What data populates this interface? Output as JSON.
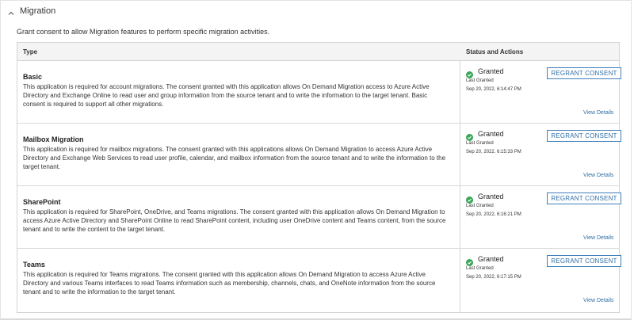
{
  "section": {
    "title": "Migration",
    "description": "Grant consent to allow Migration features to perform specific migration activities."
  },
  "table": {
    "headers": {
      "type": "Type",
      "status": "Status and Actions"
    },
    "rows": [
      {
        "title": "Basic",
        "description": "This application is required for account migrations. The consent granted with this application allows On Demand Migration access to Azure Active Directory and Exchange Online to read user and group information from the source tenant and to write the information to the target tenant. Basic consent is required to support all other migrations.",
        "status": "Granted",
        "last_granted_label": "Last Granted",
        "last_granted_date": "Sep 20, 2022, 6:14:47 PM",
        "button_label": "REGRANT CONSENT",
        "details_label": "View Details"
      },
      {
        "title": "Mailbox Migration",
        "description": "This application is required for mailbox migrations. The consent granted with this applications allows On Demand Migration to access Azure Active Directory and Exchange Web Services to read user profile, calendar, and mailbox information from the source tenant and to write the information to the target tenant.",
        "status": "Granted",
        "last_granted_label": "Last Granted",
        "last_granted_date": "Sep 20, 2022, 6:15:33 PM",
        "button_label": "REGRANT CONSENT",
        "details_label": "View Details"
      },
      {
        "title": "SharePoint",
        "description": "This application is required for SharePoint, OneDrive, and Teams migrations. The consent granted with this application allows On Demand Migration to access Azure Active Directory and SharePoint Online to read SharePoint content, including user OneDrive content and Teams content, from the source tenant and to write the content to the target tenant.",
        "status": "Granted",
        "last_granted_label": "Last Granted",
        "last_granted_date": "Sep 20, 2022, 6:16:21 PM",
        "button_label": "REGRANT CONSENT",
        "details_label": "View Details"
      },
      {
        "title": "Teams",
        "description": "This application is required for Teams migrations. The consent granted with this application allows On Demand Migration to access Azure Active Directory and various Teams interfaces to read Teams information such as membership, channels, chats, and OneNote information from the source tenant and to write the information to the target tenant.",
        "status": "Granted",
        "last_granted_label": "Last Granted",
        "last_granted_date": "Sep 20, 2022, 6:17:15 PM",
        "button_label": "REGRANT CONSENT",
        "details_label": "View Details"
      }
    ]
  },
  "icons": {
    "collapse": "chevron-up-icon",
    "status": "check-circle-icon"
  },
  "colors": {
    "accent": "#2f6ea5",
    "success": "#3aa657"
  }
}
